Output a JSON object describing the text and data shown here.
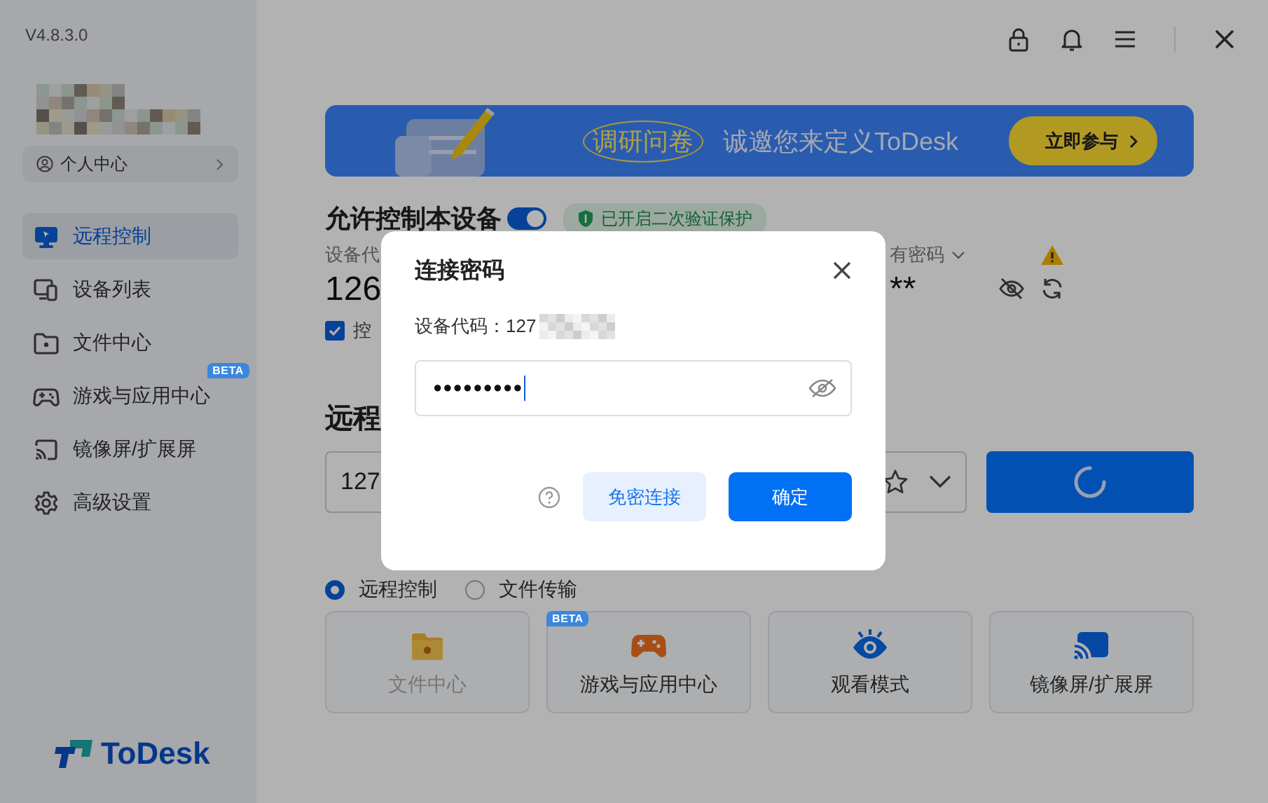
{
  "app": {
    "version": "V4.8.3.0",
    "logo": "ToDesk"
  },
  "sidebar": {
    "profile_button": "个人中心",
    "items": [
      {
        "label": "远程控制",
        "kind": "monitor",
        "selected": true
      },
      {
        "label": "设备列表",
        "kind": "devices",
        "selected": false
      },
      {
        "label": "文件中心",
        "kind": "folder",
        "selected": false
      },
      {
        "label": "游戏与应用中心",
        "kind": "gamepad",
        "selected": false,
        "badge": "BETA"
      },
      {
        "label": "镜像屏/扩展屏",
        "kind": "cast",
        "selected": false
      },
      {
        "label": "高级设置",
        "kind": "gear",
        "selected": false
      }
    ]
  },
  "banner": {
    "tag": "调研问卷",
    "text": "诚邀您来定义ToDesk",
    "button": "立即参与"
  },
  "allow_control": {
    "title": "允许控制本设备",
    "on": true,
    "badge": "已开启二次验证保护"
  },
  "device_code": {
    "label": "设备代",
    "value": "126"
  },
  "password": {
    "label": "有密码",
    "value": "**"
  },
  "control_checkbox": {
    "label": "控",
    "checked": true
  },
  "remote": {
    "title": "远程",
    "input_value": "127"
  },
  "modes": [
    {
      "label": "远程控制",
      "selected": true
    },
    {
      "label": "文件传输",
      "selected": false
    }
  ],
  "cards": [
    {
      "label": "文件中心",
      "kind": "folder",
      "disabled": true
    },
    {
      "label": "游戏与应用中心",
      "kind": "gamepad",
      "disabled": false,
      "badge": "BETA"
    },
    {
      "label": "观看模式",
      "kind": "eye",
      "disabled": false
    },
    {
      "label": "镜像屏/扩展屏",
      "kind": "cast",
      "disabled": false
    }
  ],
  "dialog": {
    "title": "连接密码",
    "device_code_label": "设备代码：",
    "device_code": "127",
    "password": "●●●●●●●●●",
    "secondary_button": "免密连接",
    "primary_button": "确定"
  }
}
